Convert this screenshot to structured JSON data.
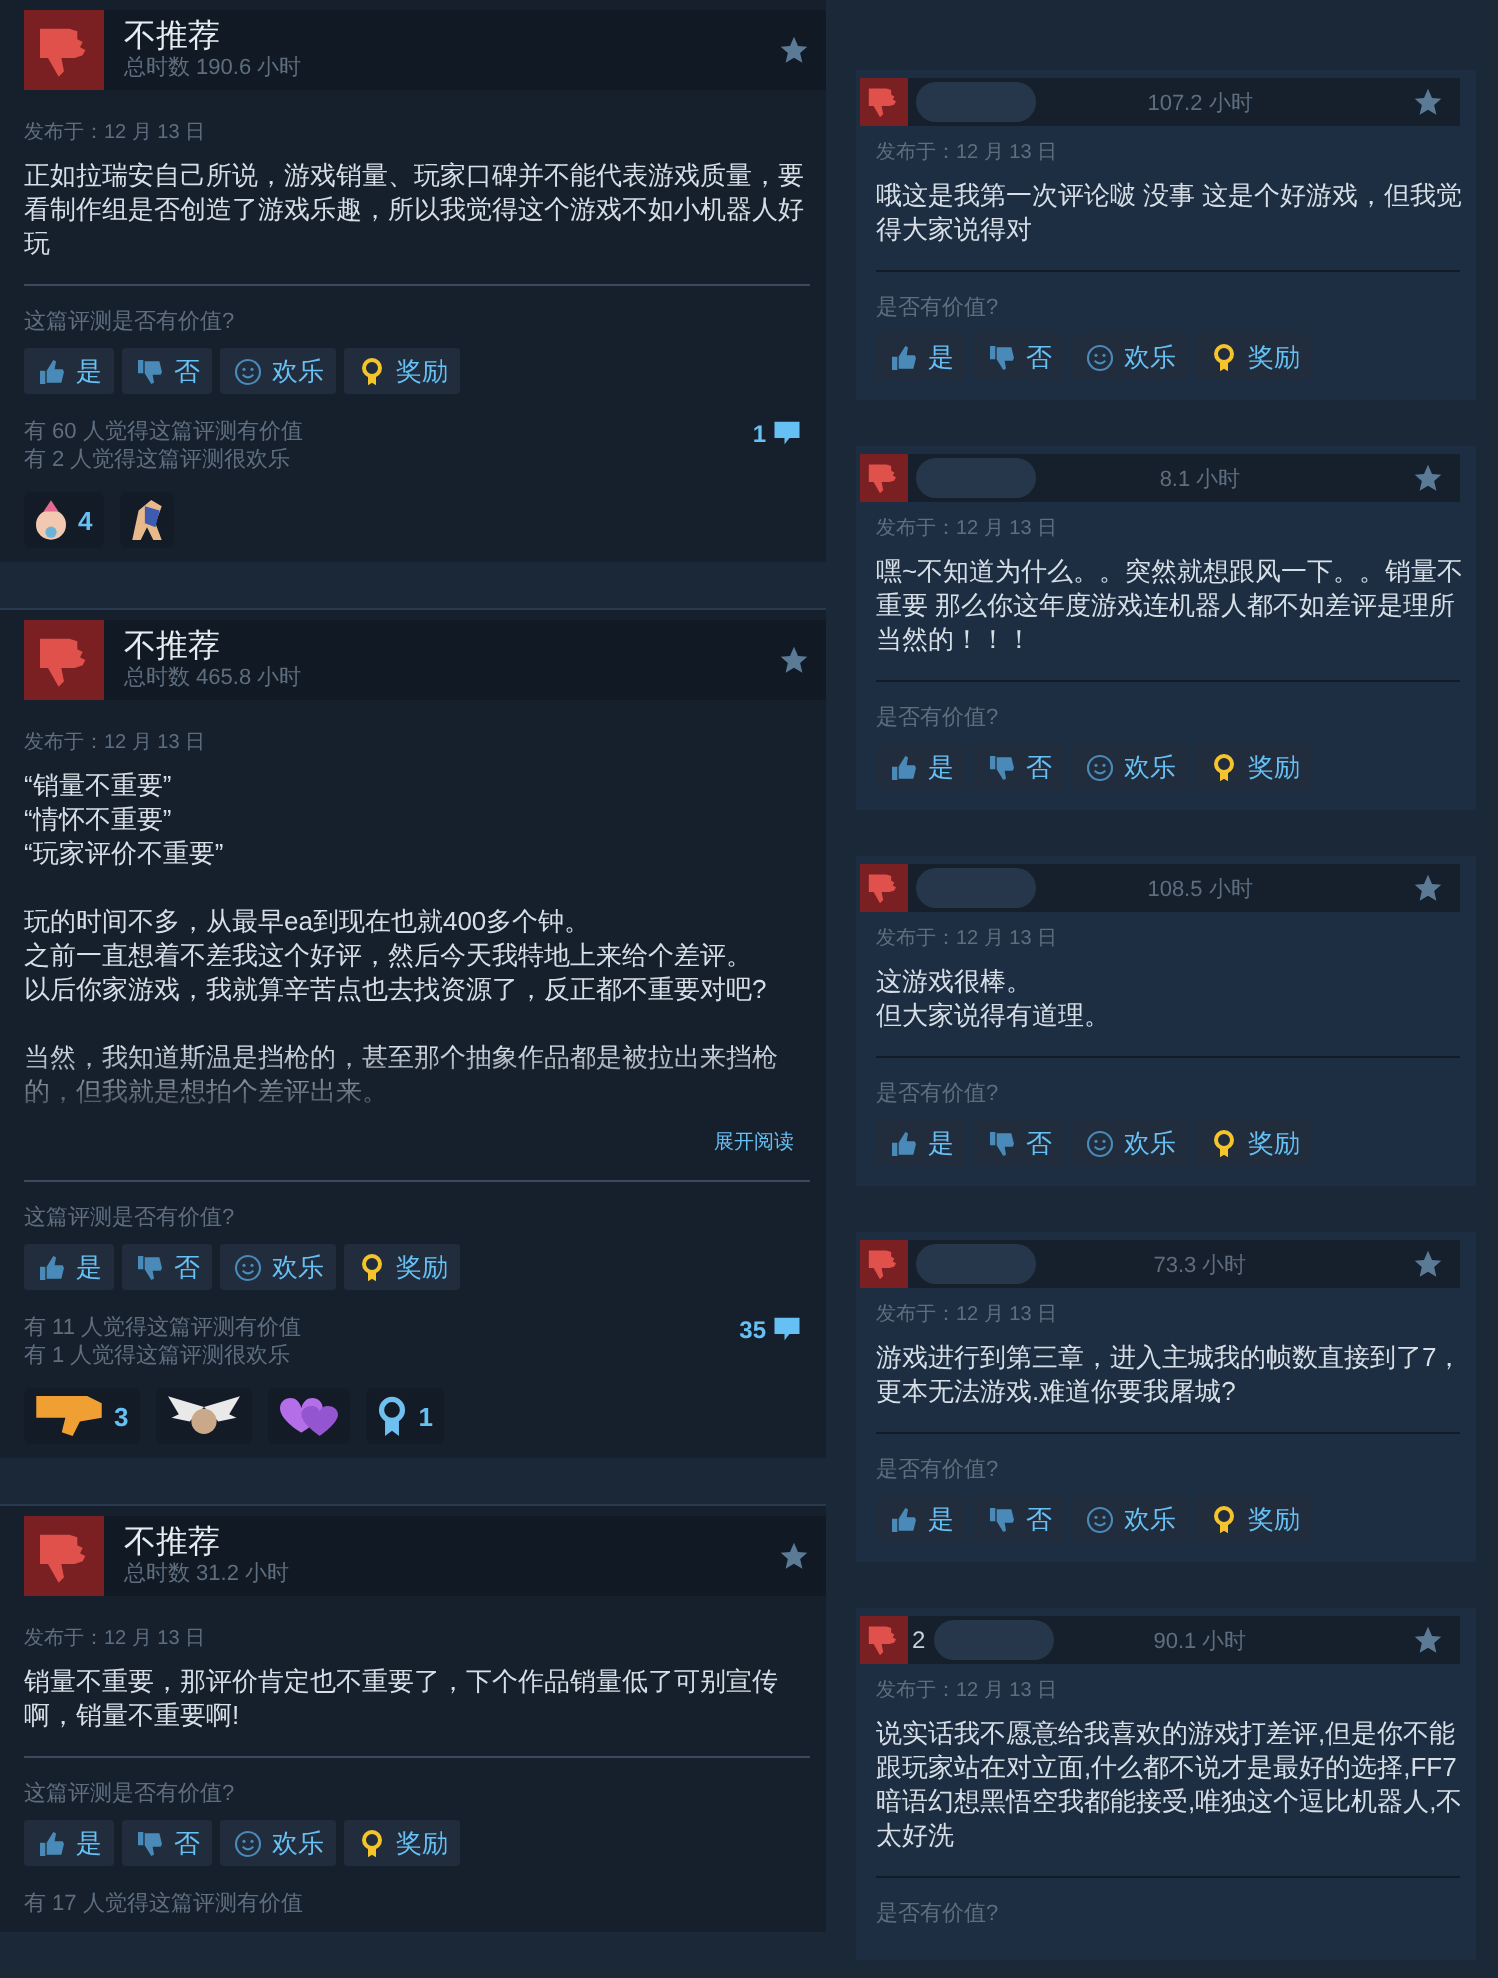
{
  "left_reviews": [
    {
      "verdict": "不推荐",
      "hours": "总时数 190.6 小时",
      "date": "发布于：12 月 13 日",
      "paragraphs": [
        [
          "正如拉瑞安自己所说，游戏销量、玩家口碑并不能代表游戏质量，要看制作组是否创造了游戏乐趣，所以我觉得这个游戏不如小机器人好玩"
        ]
      ],
      "expanded": true,
      "question": "这篇评测是否有价值?",
      "buttons": [
        {
          "kind": "yes",
          "label": "是"
        },
        {
          "kind": "no",
          "label": "否"
        },
        {
          "kind": "funny",
          "label": "欢乐"
        },
        {
          "kind": "award",
          "label": "奖励"
        }
      ],
      "helpful": "有 60 人觉得这篇评测有价值",
      "funny": "有 2 人觉得这篇评测很欢乐",
      "comments": "1",
      "awards": [
        {
          "kind": "face",
          "count": "4"
        },
        {
          "kind": "figure"
        }
      ]
    },
    {
      "verdict": "不推荐",
      "hours": "总时数 465.8 小时",
      "date": "发布于：12 月 13 日",
      "paragraphs": [
        [
          "“销量不重要”",
          "“情怀不重要”",
          "“玩家评价不重要”"
        ],
        [
          "玩的时间不多，从最早ea到现在也就400多个钟。",
          "之前一直想着不差我这个好评，然后今天我特地上来给个差评。",
          "以后你家游戏，我就算辛苦点也去找资源了，反正都不重要对吧?"
        ],
        [
          "当然，我知道斯温是挡枪的，甚至那个抽象作品都是被拉出来挡枪的，但我就是想拍个差评出来。"
        ]
      ],
      "expanded": false,
      "more": "展开阅读",
      "question": "这篇评测是否有价值?",
      "buttons": [
        {
          "kind": "yes",
          "label": "是"
        },
        {
          "kind": "no",
          "label": "否"
        },
        {
          "kind": "funny",
          "label": "欢乐"
        },
        {
          "kind": "award",
          "label": "奖励"
        }
      ],
      "helpful": "有 11 人觉得这篇评测有价值",
      "funny": "有 1 人觉得这篇评测很欢乐",
      "comments": "35",
      "awards": [
        {
          "kind": "hand",
          "count": "3"
        },
        {
          "kind": "wings"
        },
        {
          "kind": "heart"
        },
        {
          "kind": "ribbon",
          "count": "1"
        }
      ]
    },
    {
      "verdict": "不推荐",
      "hours": "总时数 31.2 小时",
      "date": "发布于：12 月 13 日",
      "paragraphs": [
        [
          "销量不重要，那评价肯定也不重要了，下个作品销量低了可别宣传啊，销量不重要啊!"
        ]
      ],
      "expanded": true,
      "question": "这篇评测是否有价值?",
      "buttons": [
        {
          "kind": "yes",
          "label": "是"
        },
        {
          "kind": "no",
          "label": "否"
        },
        {
          "kind": "funny",
          "label": "欢乐"
        },
        {
          "kind": "award",
          "label": "奖励"
        }
      ],
      "helpful": "有 17 人觉得这篇评测有价值"
    }
  ],
  "right_reviews": [
    {
      "hours": "107.2 小时",
      "date": "发布于：12 月 13 日",
      "text": [
        "哦这是我第一次评论啵 没事 这是个好游戏，但我觉得大家说得对"
      ],
      "question": "是否有价值?",
      "buttons": [
        {
          "kind": "yes",
          "label": "是"
        },
        {
          "kind": "no",
          "label": "否"
        },
        {
          "kind": "funny",
          "label": "欢乐"
        },
        {
          "kind": "award",
          "label": "奖励"
        }
      ]
    },
    {
      "hours": "8.1 小时",
      "date": "发布于：12 月 13 日",
      "text": [
        "嘿~不知道为什么。。突然就想跟风一下。。销量不重要 那么你这年度游戏连机器人都不如差评是理所当然的！！！"
      ],
      "question": "是否有价值?",
      "buttons": [
        {
          "kind": "yes",
          "label": "是"
        },
        {
          "kind": "no",
          "label": "否"
        },
        {
          "kind": "funny",
          "label": "欢乐"
        },
        {
          "kind": "award",
          "label": "奖励"
        }
      ]
    },
    {
      "hours": "108.5 小时",
      "date": "发布于：12 月 13 日",
      "text": [
        "这游戏很棒。",
        "但大家说得有道理。"
      ],
      "question": "是否有价值?",
      "buttons": [
        {
          "kind": "yes",
          "label": "是"
        },
        {
          "kind": "no",
          "label": "否"
        },
        {
          "kind": "funny",
          "label": "欢乐"
        },
        {
          "kind": "award",
          "label": "奖励"
        }
      ]
    },
    {
      "hours": "73.3 小时",
      "date": "发布于：12 月 13 日",
      "text": [
        "游戏进行到第三章，进入主城我的帧数直接到了7，更本无法游戏.难道你要我屠城?"
      ],
      "question": "是否有价值?",
      "buttons": [
        {
          "kind": "yes",
          "label": "是"
        },
        {
          "kind": "no",
          "label": "否"
        },
        {
          "kind": "funny",
          "label": "欢乐"
        },
        {
          "kind": "award",
          "label": "奖励"
        }
      ]
    },
    {
      "name": "2",
      "hours": "90.1 小时",
      "date": "发布于：12 月 13 日",
      "text": [
        "说实话我不愿意给我喜欢的游戏打差评,但是你不能跟玩家站在对立面,什么都不说才是最好的选择,FF7暗语幻想黑悟空我都能接受,唯独这个逗比机器人,不太好洗"
      ],
      "question": "是否有价值?"
    }
  ]
}
